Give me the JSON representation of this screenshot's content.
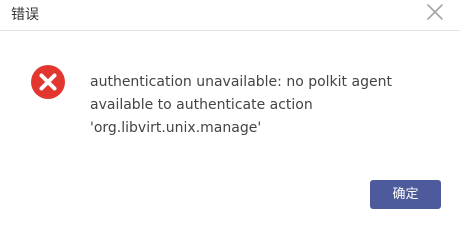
{
  "dialog": {
    "title": "错误",
    "close_icon": "close-icon",
    "status_icon": "error-circle-x-icon",
    "message_lines": [
      "authentication unavailable: no polkit agent",
      "available to authenticate action",
      "'org.libvirt.unix.manage'"
    ],
    "ok_label": "确定"
  },
  "colors": {
    "error_red": "#e1372f",
    "button_bg": "#4d5a9c",
    "button_text": "#ffffff",
    "close_icon": "#a5a5a5",
    "divider": "#e3e3e3"
  }
}
